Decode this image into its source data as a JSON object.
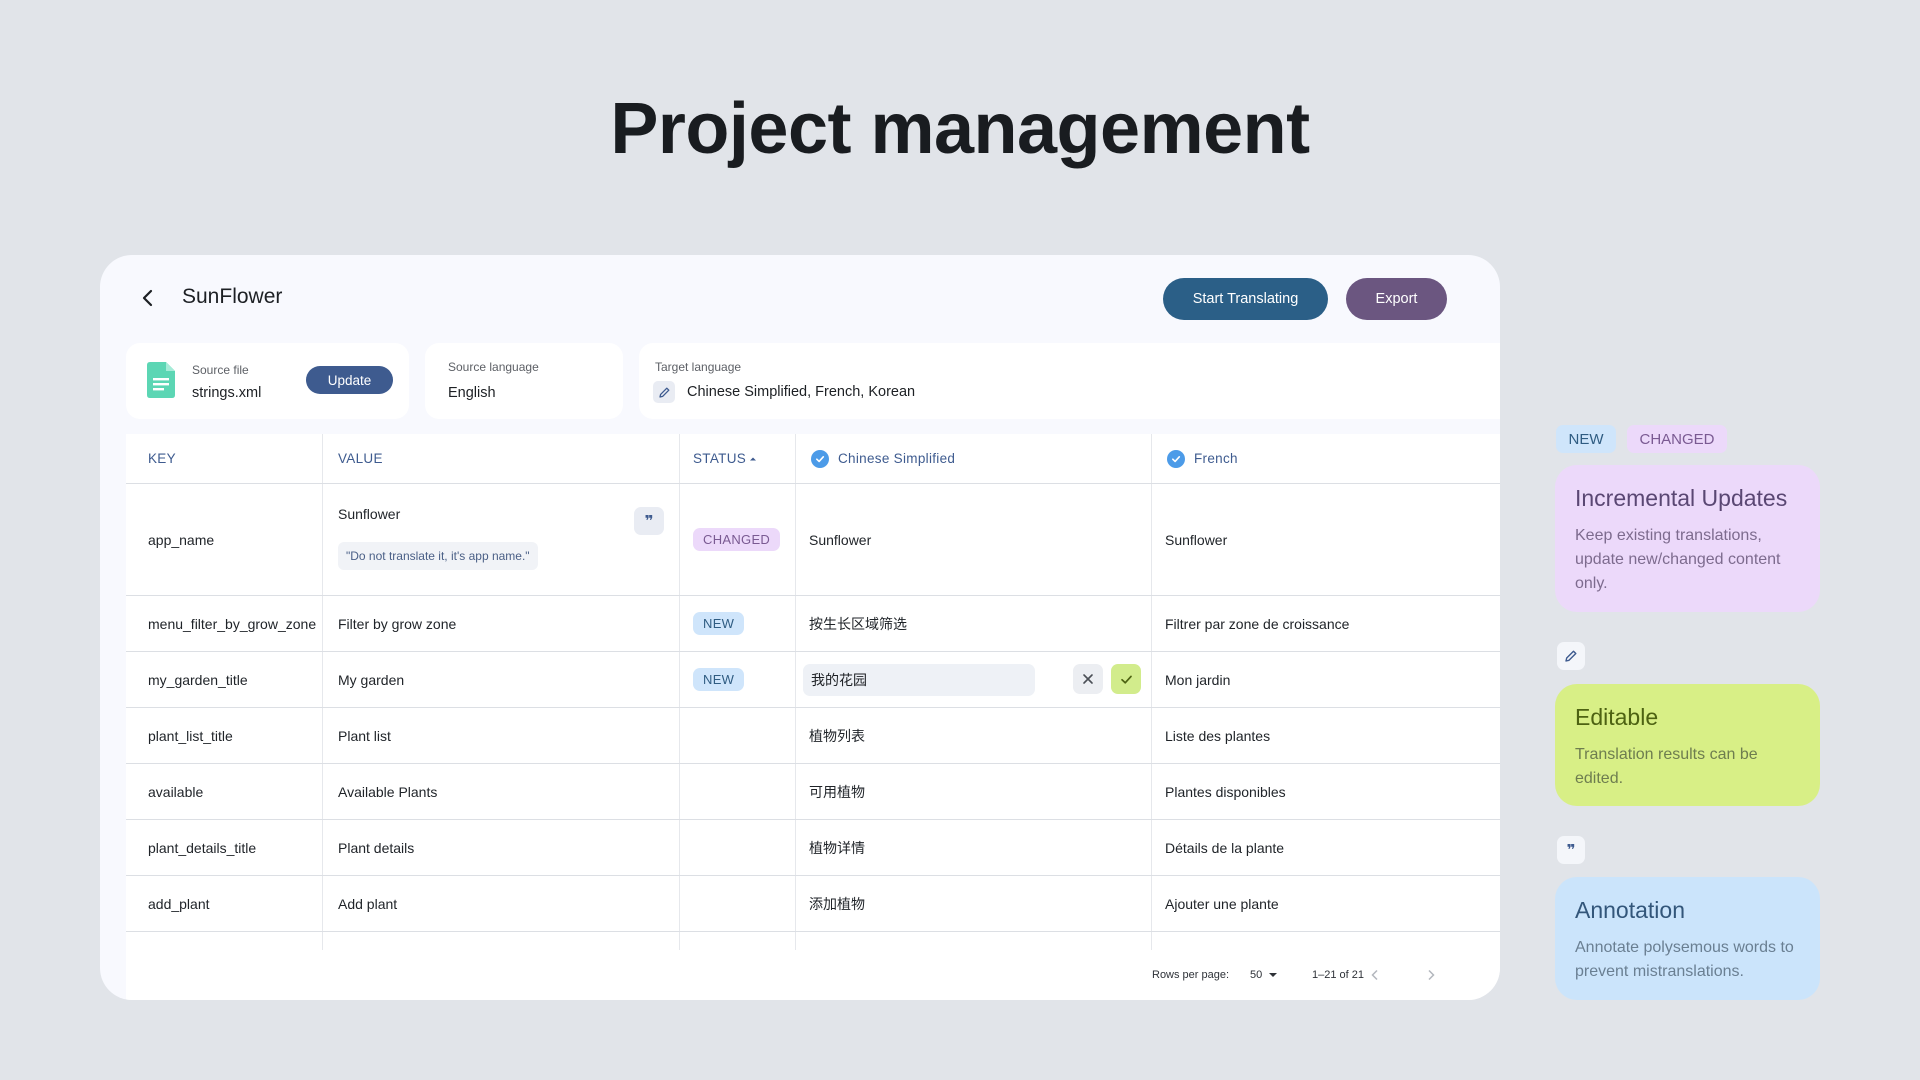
{
  "headline": "Project management",
  "project": {
    "title": "SunFlower",
    "start_label": "Start Translating",
    "export_label": "Export"
  },
  "source_file": {
    "label": "Source file",
    "value": "strings.xml",
    "update_label": "Update"
  },
  "source_language": {
    "label": "Source language",
    "value": "English"
  },
  "target_language": {
    "label": "Target language",
    "value": "Chinese Simplified, French, Korean"
  },
  "table": {
    "headers": {
      "key": "KEY",
      "value": "VALUE",
      "status": "STATUS",
      "lang1": "Chinese Simplified",
      "lang2": "French"
    },
    "rows": [
      {
        "key": "app_name",
        "value": "Sunflower",
        "note": "\"Do not translate it, it's app name.\"",
        "status": "CHANGED",
        "zh": "Sunflower",
        "fr": "Sunflower"
      },
      {
        "key": "menu_filter_by_grow_zone",
        "value": "Filter by grow zone",
        "status": "NEW",
        "zh": "按生长区域筛选",
        "fr": "Filtrer par zone de croissance"
      },
      {
        "key": "my_garden_title",
        "value": "My garden",
        "status": "NEW",
        "zh": "我的花园",
        "fr": "Mon jardin"
      },
      {
        "key": "plant_list_title",
        "value": "Plant list",
        "status": "",
        "zh": "植物列表",
        "fr": "Liste des plantes"
      },
      {
        "key": "available",
        "value": "Available Plants",
        "status": "",
        "zh": "可用植物",
        "fr": "Plantes disponibles"
      },
      {
        "key": "plant_details_title",
        "value": "Plant details",
        "status": "",
        "zh": "植物详情",
        "fr": "Détails de la plante"
      },
      {
        "key": "add_plant",
        "value": "Add plant",
        "status": "",
        "zh": "添加植物",
        "fr": "Ajouter une plante"
      }
    ],
    "footer": {
      "rows_per_page_label": "Rows per page:",
      "rows_per_page_value": "50",
      "range": "1–21 of 21"
    }
  },
  "features": {
    "badge_new": "NEW",
    "badge_changed": "CHANGED",
    "incremental": {
      "title": "Incremental Updates",
      "desc": "Keep existing translations, update new/changed content only."
    },
    "editable": {
      "title": "Editable",
      "desc": "Translation results can be edited."
    },
    "annotation": {
      "title": "Annotation",
      "desc": "Annotate polysemous words to prevent mistranslations."
    }
  },
  "colors": {
    "primary": "#2b5f87",
    "secondary": "#6b5680",
    "new_badge": "#cfe5fb",
    "changed_badge": "#ecd9fa",
    "editable_card": "#d8ef86",
    "annotation_card": "#cbe4fb"
  }
}
